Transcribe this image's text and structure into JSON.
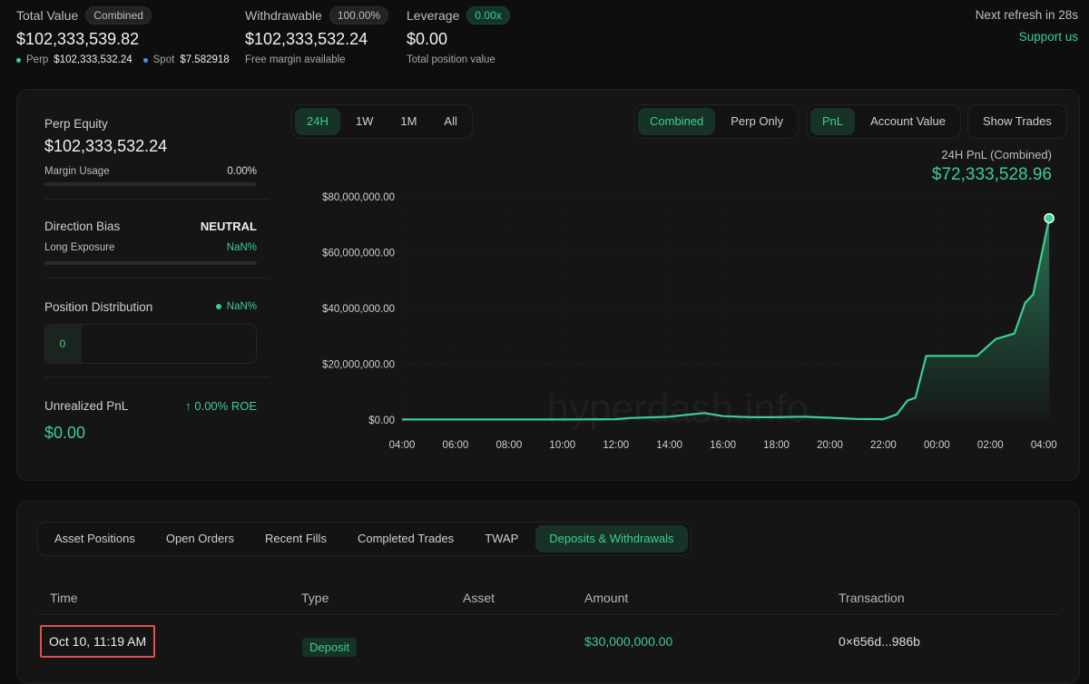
{
  "summary": {
    "total_value": {
      "label": "Total Value",
      "badge": "Combined",
      "value": "$102,333,539.82",
      "perp_label": "Perp",
      "perp_value": "$102,333,532.24",
      "spot_label": "Spot",
      "spot_value": "$7.582918"
    },
    "withdrawable": {
      "label": "Withdrawable",
      "badge": "100.00%",
      "value": "$102,333,532.24",
      "sub": "Free margin available"
    },
    "leverage": {
      "label": "Leverage",
      "badge": "0.00x",
      "value": "$0.00",
      "sub": "Total position value"
    },
    "next_refresh": "Next refresh in 28s",
    "support": "Support us"
  },
  "stats": {
    "perp_equity": {
      "label": "Perp Equity",
      "value": "$102,333,532.24",
      "margin_label": "Margin Usage",
      "margin_value": "0.00%"
    },
    "direction": {
      "label": "Direction Bias",
      "value": "NEUTRAL",
      "long_label": "Long Exposure",
      "long_value": "NaN%"
    },
    "position_distribution": {
      "label": "Position Distribution",
      "value": "NaN%",
      "count": "0"
    },
    "unrealized": {
      "label": "Unrealized PnL",
      "roe": "↑ 0.00% ROE",
      "value": "$0.00"
    }
  },
  "toolbar": {
    "ranges": [
      "24H",
      "1W",
      "1M",
      "All"
    ],
    "modes": [
      "Combined",
      "Perp Only"
    ],
    "metrics": [
      "PnL",
      "Account Value"
    ],
    "show_trades": "Show Trades"
  },
  "pnl_header": {
    "label": "24H PnL (Combined)",
    "value": "$72,333,528.96"
  },
  "watermark": "hyperdash.info",
  "chart_data": {
    "type": "area",
    "title": "",
    "xlabel": "",
    "ylabel": "",
    "ylim": [
      0,
      80000000
    ],
    "y_ticks": [
      "$0.00",
      "$20,000,000.00",
      "$40,000,000.00",
      "$60,000,000.00",
      "$80,000,000.00"
    ],
    "x_ticks": [
      "04:00",
      "06:00",
      "08:00",
      "10:00",
      "12:00",
      "14:00",
      "16:00",
      "18:00",
      "20:00",
      "22:00",
      "00:00",
      "02:00",
      "04:00"
    ],
    "x_hours": [
      0,
      2,
      4,
      6,
      8,
      10,
      12,
      14,
      16,
      18,
      20,
      22,
      24
    ],
    "series": [
      {
        "x": [
          0,
          2,
          4,
          6,
          8,
          8.5,
          9.5,
          10,
          11.3,
          12,
          13,
          14,
          15,
          16,
          17,
          18,
          18.5,
          18.9,
          19.2,
          19.6,
          20,
          21,
          21.5,
          22.2,
          22.9,
          23.3,
          23.6,
          24.2
        ],
        "y": [
          200000,
          200000,
          200000,
          200000,
          300000,
          700000,
          1000000,
          1200000,
          2500000,
          1400000,
          1000000,
          1000000,
          1200000,
          800000,
          400000,
          300000,
          2000000,
          7000000,
          8000000,
          23000000,
          23000000,
          23000000,
          23000000,
          29000000,
          31000000,
          42000000,
          45000000,
          72333528.96
        ]
      }
    ],
    "color": "#3ccf91",
    "grid": true
  },
  "tabs": [
    "Asset Positions",
    "Open Orders",
    "Recent Fills",
    "Completed Trades",
    "TWAP",
    "Deposits & Withdrawals"
  ],
  "table": {
    "columns": [
      "Time",
      "Type",
      "Asset",
      "Amount",
      "Transaction"
    ],
    "rows": [
      {
        "time": "Oct 10, 11:19 AM",
        "type": "Deposit",
        "asset": "",
        "amount": "$30,000,000.00",
        "tx": "0×656d...986b"
      }
    ]
  },
  "colors": {
    "accent": "#3ccf91",
    "perp_dot": "#3ccf91",
    "spot_dot": "#4f8ff7",
    "highlight": "#e05050"
  }
}
